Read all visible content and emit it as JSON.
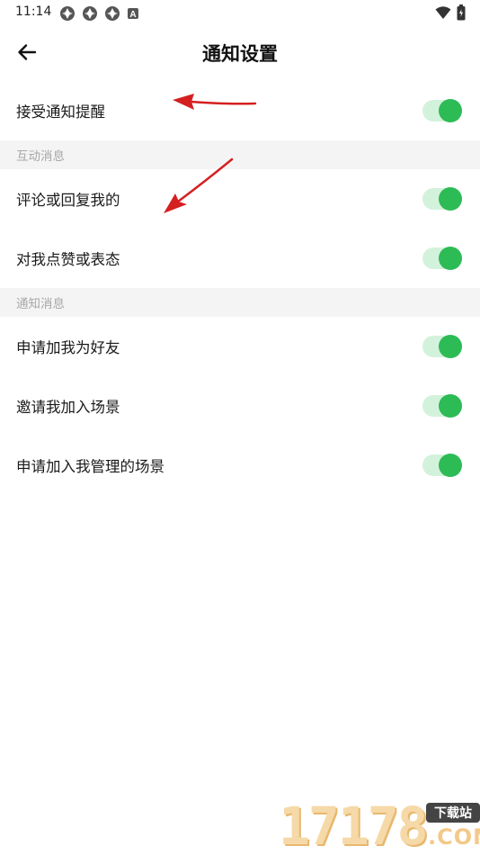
{
  "status_bar": {
    "time": "11:14",
    "icons": [
      "app-notification-icon",
      "app-notification-icon",
      "app-notification-icon",
      "a-badge-icon"
    ],
    "a_badge": "A",
    "right_icons": [
      "wifi-icon",
      "battery-icon"
    ]
  },
  "header": {
    "title": "通知设置",
    "back_icon": "arrow-left-icon"
  },
  "main": {
    "top_item": {
      "label": "接受通知提醒",
      "enabled": true
    },
    "sections": [
      {
        "title": "互动消息",
        "items": [
          {
            "label": "评论或回复我的",
            "enabled": true
          },
          {
            "label": "对我点赞或表态",
            "enabled": true
          }
        ]
      },
      {
        "title": "通知消息",
        "items": [
          {
            "label": "申请加我为好友",
            "enabled": true
          },
          {
            "label": "邀请我加入场景",
            "enabled": true
          },
          {
            "label": "申请加入我管理的场景",
            "enabled": true
          }
        ]
      }
    ]
  },
  "watermark": {
    "number": "17178",
    "tag": "下载站",
    "domain": ".COM"
  },
  "colors": {
    "toggle_track": "#d3f2dc",
    "toggle_knob": "#2dbb55",
    "section_bg": "#f4f4f4",
    "annotation_arrow": "#d42020"
  }
}
